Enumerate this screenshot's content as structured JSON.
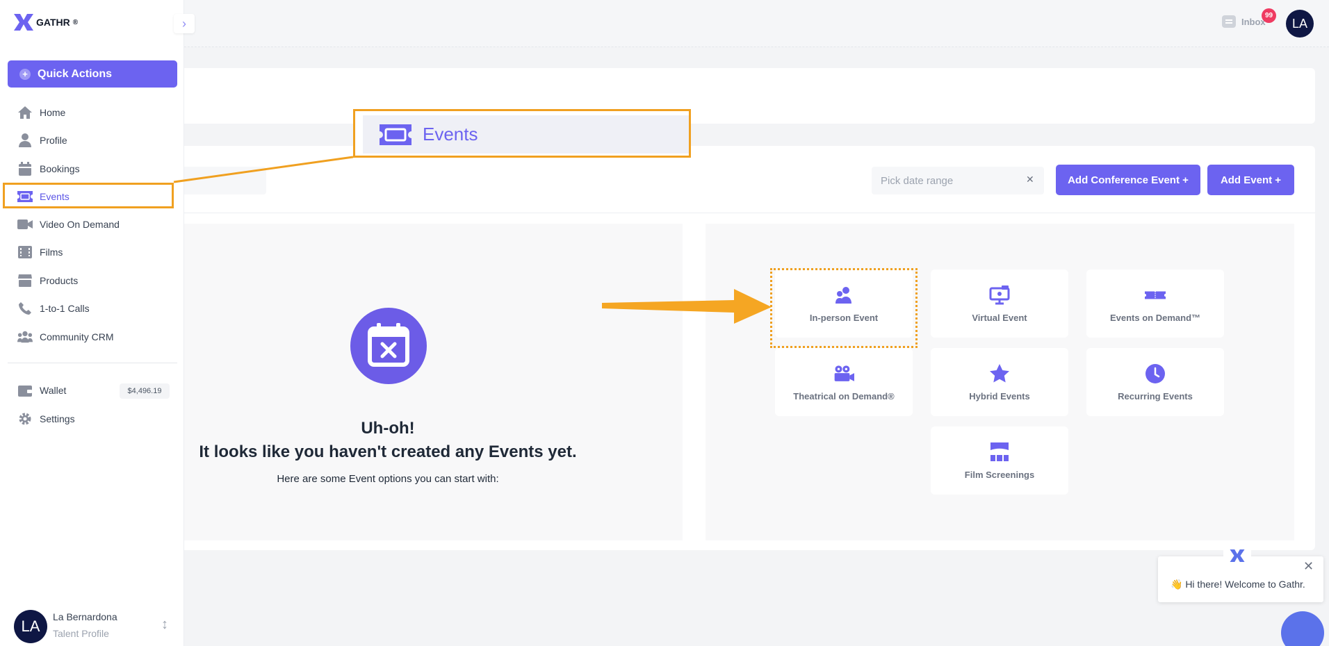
{
  "brand": {
    "name": "GATHR",
    "mark": "®"
  },
  "topbar": {
    "inbox_label": "Inbox",
    "inbox_count": "99",
    "avatar_initials": "LA"
  },
  "sidebar": {
    "quick_actions": "Quick Actions",
    "items": [
      {
        "label": "Home",
        "icon": "home-icon"
      },
      {
        "label": "Profile",
        "icon": "user-icon"
      },
      {
        "label": "Bookings",
        "icon": "calendar-icon"
      },
      {
        "label": "Events",
        "icon": "ticket-icon",
        "active": true
      },
      {
        "label": "Video On Demand",
        "icon": "video-icon"
      },
      {
        "label": "Films",
        "icon": "film-icon"
      },
      {
        "label": "Products",
        "icon": "store-icon"
      },
      {
        "label": "1-to-1 Calls",
        "icon": "phone-icon"
      },
      {
        "label": "Community CRM",
        "icon": "users-icon"
      }
    ],
    "wallet": {
      "label": "Wallet",
      "amount": "$4,496.19"
    },
    "settings": "Settings",
    "user": {
      "initials": "LA",
      "name": "La Bernardona",
      "role": "Talent Profile"
    }
  },
  "zoom_callout": {
    "label": "Events"
  },
  "toolbar": {
    "date_placeholder": "Pick date range",
    "add_conference": "Add Conference Event +",
    "add_event": "Add Event +"
  },
  "empty_state": {
    "title": "Uh-oh!",
    "subtitle": "It looks like you haven't created any Events yet.",
    "hint": "Here are some Event options you can start with:"
  },
  "event_options": [
    {
      "label": "In-person Event",
      "icon": "people-icon"
    },
    {
      "label": "Virtual Event",
      "icon": "presentation-icon"
    },
    {
      "label": "Events on Demand™",
      "icon": "ticket-strip-icon"
    },
    {
      "label": "Theatrical on Demand®",
      "icon": "camera-icon"
    },
    {
      "label": "Hybrid Events",
      "icon": "star-icon"
    },
    {
      "label": "Recurring Events",
      "icon": "clock-icon"
    },
    {
      "label": "Film Screenings",
      "icon": "cinema-icon"
    }
  ],
  "chat": {
    "greeting": "👋 Hi there! Welcome to Gathr."
  },
  "colors": {
    "accent": "#6c63f0",
    "annotation": "#f0a020",
    "navy": "#0f1744"
  }
}
